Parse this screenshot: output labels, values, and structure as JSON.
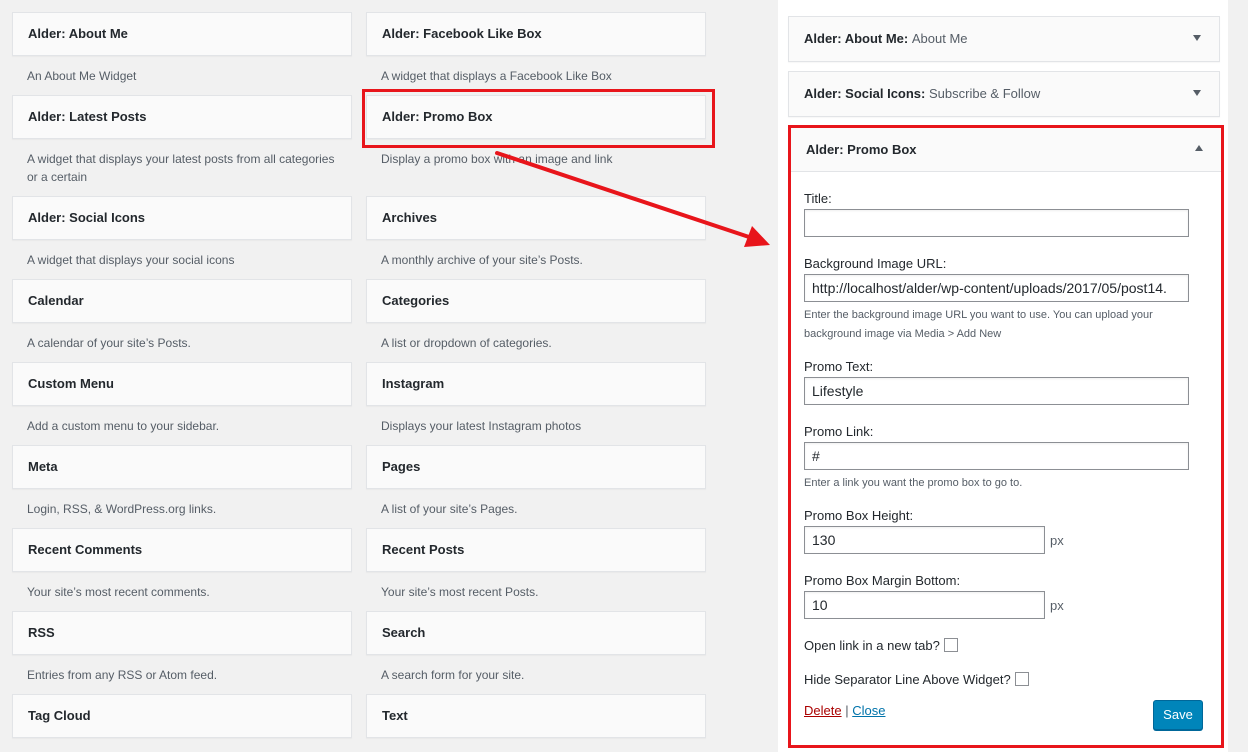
{
  "available_widgets": {
    "left_column": [
      {
        "title": "Alder: About Me",
        "desc": "An About Me Widget"
      },
      {
        "title": "Alder: Latest Posts",
        "desc": "A widget that displays your latest posts from all categories or a certain"
      },
      {
        "title": "Alder: Social Icons",
        "desc": "A widget that displays your social icons"
      },
      {
        "title": "Calendar",
        "desc": "A calendar of your site’s Posts."
      },
      {
        "title": "Custom Menu",
        "desc": "Add a custom menu to your sidebar."
      },
      {
        "title": "Meta",
        "desc": "Login, RSS, & WordPress.org links."
      },
      {
        "title": "Recent Comments",
        "desc": "Your site’s most recent comments."
      },
      {
        "title": "RSS",
        "desc": "Entries from any RSS or Atom feed."
      },
      {
        "title": "Tag Cloud",
        "desc": ""
      }
    ],
    "right_column": [
      {
        "title": "Alder: Facebook Like Box",
        "desc": "A widget that displays a Facebook Like Box"
      },
      {
        "title": "Alder: Promo Box",
        "desc": "Display a promo box with an image and link"
      },
      {
        "title": "Archives",
        "desc": "A monthly archive of your site’s Posts."
      },
      {
        "title": "Categories",
        "desc": "A list or dropdown of categories."
      },
      {
        "title": "Instagram",
        "desc": "Displays your latest Instagram photos"
      },
      {
        "title": "Pages",
        "desc": "A list of your site’s Pages."
      },
      {
        "title": "Recent Posts",
        "desc": "Your site’s most recent Posts."
      },
      {
        "title": "Search",
        "desc": "A search form for your site."
      },
      {
        "title": "Text",
        "desc": ""
      }
    ]
  },
  "sidebar": {
    "widgets": [
      {
        "name": "Alder: About Me:",
        "in_title": "About Me"
      },
      {
        "name": "Alder: Social Icons:",
        "in_title": "Subscribe & Follow"
      }
    ],
    "promo": {
      "title": "Alder: Promo Box",
      "fields": {
        "title_label": "Title:",
        "title_value": "",
        "bg_label": "Background Image URL:",
        "bg_value": "http://localhost/alder/wp-content/uploads/2017/05/post14.",
        "bg_help": "Enter the background image URL you want to use. You can upload your background image via Media > Add New",
        "promo_text_label": "Promo Text:",
        "promo_text_value": "Lifestyle",
        "promo_link_label": "Promo Link:",
        "promo_link_value": "#",
        "promo_link_help": "Enter a link you want the promo box to go to.",
        "height_label": "Promo Box Height:",
        "height_value": "130",
        "height_unit": "px",
        "margin_label": "Promo Box Margin Bottom:",
        "margin_value": "10",
        "margin_unit": "px",
        "newtab_label": "Open link in a new tab?",
        "separator_label": "Hide Separator Line Above Widget?"
      },
      "delete_label": "Delete",
      "separator": "|",
      "close_label": "Close",
      "save_label": "Save"
    }
  },
  "colors": {
    "annotation": "#e8151b",
    "primary_button": "#0085ba",
    "delete_link": "#aa0000",
    "close_link": "#0073aa"
  }
}
